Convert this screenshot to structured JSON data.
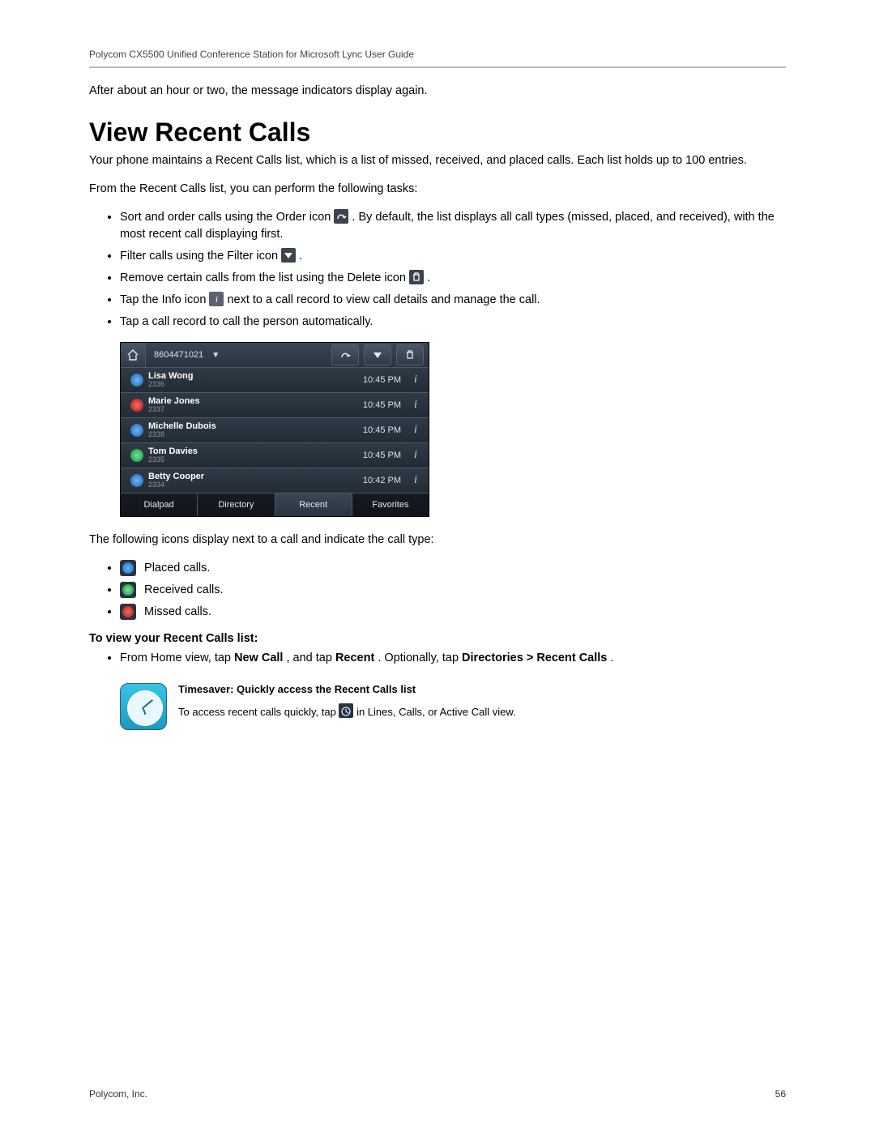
{
  "header": {
    "doc_title": "Polycom CX5500 Unified Conference Station for Microsoft Lync User Guide"
  },
  "intro_line": "After about an hour or two, the message indicators display again.",
  "h1": "View Recent Calls",
  "p1": "Your phone maintains a Recent Calls list, which is a list of missed, received, and placed calls. Each list holds up to 100 entries.",
  "p2": "From the Recent Calls list, you can perform the following tasks:",
  "tasks": {
    "t1_a": "Sort and order calls using the Order icon ",
    "t1_b": ". By default, the list displays all call types (missed, placed, and received), with the most recent call displaying first.",
    "t2_a": "Filter calls using the Filter icon ",
    "t2_b": ".",
    "t3_a": "Remove certain calls from the list using the Delete icon ",
    "t3_b": ".",
    "t4_a": "Tap the Info icon ",
    "t4_b": " next to a call record to view call details and manage the call.",
    "t5": "Tap a call record to call the person automatically."
  },
  "phone": {
    "number": "8604471021",
    "rows": [
      {
        "name": "Lisa Wong",
        "ext": "2336",
        "time": "10:45 PM",
        "type": "placed"
      },
      {
        "name": "Marie Jones",
        "ext": "2337",
        "time": "10:45 PM",
        "type": "missed"
      },
      {
        "name": "Michelle Dubois",
        "ext": "2338",
        "time": "10:45 PM",
        "type": "placed"
      },
      {
        "name": "Tom Davies",
        "ext": "2335",
        "time": "10:45 PM",
        "type": "received"
      },
      {
        "name": "Betty Cooper",
        "ext": "2334",
        "time": "10:42 PM",
        "type": "placed"
      }
    ],
    "tabs": [
      "Dialpad",
      "Directory",
      "Recent",
      "Favorites"
    ],
    "active_tab": 2
  },
  "p3": "The following icons display next to a call and indicate the call type:",
  "legend": {
    "placed": "Placed calls.",
    "received": "Received calls.",
    "missed": "Missed calls."
  },
  "subhead": "To view your Recent Calls list:",
  "howto_a": "From Home view, tap ",
  "howto_b": "New Call",
  "howto_c": ", and tap ",
  "howto_d": "Recent",
  "howto_e": ". Optionally, tap ",
  "howto_f": "Directories > Recent Calls",
  "howto_g": ".",
  "timesaver": {
    "title": "Timesaver: Quickly access the Recent Calls list",
    "body_a": "To access recent calls quickly, tap ",
    "body_b": " in Lines, Calls, or Active Call view."
  },
  "footer": {
    "left": "Polycom, Inc.",
    "right": "56"
  }
}
